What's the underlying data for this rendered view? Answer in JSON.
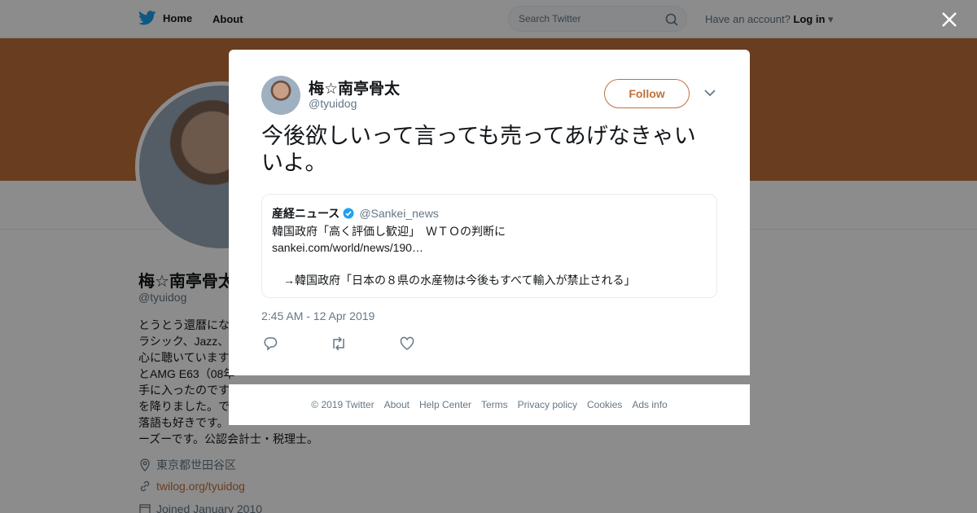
{
  "topbar": {
    "home_label": "Home",
    "about_label": "About",
    "search_placeholder": "Search Twitter",
    "account_prompt": "Have an account?",
    "login_label": "Log in"
  },
  "profile": {
    "name": "梅☆南亭骨太",
    "handle": "@tyuidog",
    "bio_lines": [
      "とうとう還暦にな",
      "ラシック、Jazz、",
      "心に聴いています",
      "とAMG E63（08年",
      "手に入ったのです",
      "を降りました。で",
      "落語も好きです。",
      "ーズーです。公認会計士・税理士。"
    ],
    "location": "東京都世田谷区",
    "website": "twilog.org/tyuidog",
    "joined": "Joined January 2010"
  },
  "tweet": {
    "author_name": "梅☆南亭骨太",
    "author_handle": "@tyuidog",
    "follow_label": "Follow",
    "text": "今後欲しいって言っても売ってあげなきゃいいよ。",
    "quote": {
      "name": "産経ニュース",
      "handle": "@Sankei_news",
      "line1": "韓国政府「高く評価し歓迎」　ＷＴＯの判断に",
      "line2": "sankei.com/world/news/190…",
      "line3": "→韓国政府「日本の８県の水産物は今後もすべて輸入が禁止される」"
    },
    "timestamp": "2:45 AM - 12 Apr 2019"
  },
  "footer": {
    "copyright": "© 2019 Twitter",
    "links": [
      "About",
      "Help Center",
      "Terms",
      "Privacy policy",
      "Cookies",
      "Ads info"
    ]
  },
  "colors": {
    "accent": "#c0703a",
    "verified": "#1da1f2",
    "twitter_blue": "#1da1f2"
  }
}
